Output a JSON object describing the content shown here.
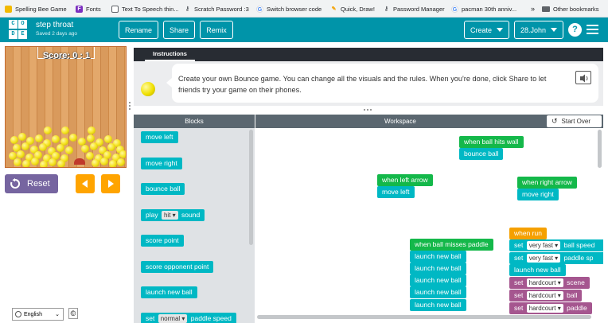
{
  "bookmarks": [
    {
      "label": "Spelling Bee Game",
      "icon": "spelling-bee-icon",
      "color": "#f2b900"
    },
    {
      "label": "Fonts",
      "icon": "fonts-icon",
      "color": "#7b2fbf"
    },
    {
      "label": "Text To Speech thin...",
      "icon": "document-icon",
      "color": "#5f6368"
    },
    {
      "label": "Scratch Password :3",
      "icon": "key-icon",
      "color": "#5f6368"
    },
    {
      "label": "Switch browser code",
      "icon": "google-icon",
      "color": "#4285f4"
    },
    {
      "label": "Quick, Draw!",
      "icon": "quick-draw-icon",
      "color": "#f4c20d"
    },
    {
      "label": "Password Manager",
      "icon": "key-icon",
      "color": "#5f6368"
    },
    {
      "label": "pacman 30th anniv...",
      "icon": "google-icon",
      "color": "#4285f4"
    },
    {
      "label": "»",
      "icon": "",
      "color": ""
    },
    {
      "label": "Other bookmarks",
      "icon": "folder-icon",
      "color": "#5f6368"
    }
  ],
  "logo_letters": [
    "C",
    "O",
    "D",
    "E"
  ],
  "project": {
    "title": "step throat",
    "saved": "Saved 2 days ago"
  },
  "header_buttons": {
    "rename": "Rename",
    "share": "Share",
    "remix": "Remix",
    "create": "Create",
    "user": "28.John",
    "help": "?"
  },
  "game": {
    "score_text": "Score: 0 : 1"
  },
  "controls": {
    "reset": "Reset"
  },
  "instructions": {
    "tab": "Instructions",
    "text": "Create your own Bounce game. You can change all the visuals and the rules. When you're done, click Share to let friends try your game on their phones."
  },
  "panels": {
    "blocks": "Blocks",
    "workspace": "Workspace",
    "start_over": "Start Over"
  },
  "toolbox": [
    {
      "label": "move left",
      "color": "teal"
    },
    {
      "label": "move right",
      "color": "teal"
    },
    {
      "label": "bounce ball",
      "color": "teal"
    },
    {
      "label": "play",
      "field": "hit",
      "suffix": "sound",
      "color": "teal"
    },
    {
      "label": "score point",
      "color": "teal"
    },
    {
      "label": "score opponent point",
      "color": "teal"
    },
    {
      "label": "launch new ball",
      "color": "teal"
    },
    {
      "label": "set",
      "field": "normal",
      "suffix": "paddle speed",
      "color": "teal"
    }
  ],
  "workspace_blocks": {
    "hits_wall": {
      "event": "when ball hits wall",
      "action": "bounce ball"
    },
    "left_arrow": {
      "event": "when left arrow",
      "action": "move left"
    },
    "right_arrow": {
      "event": "when right arrow",
      "action": "move right"
    },
    "misses_paddle": {
      "event": "when ball misses paddle",
      "actions": [
        "launch new ball",
        "launch new ball",
        "launch new ball",
        "launch new ball",
        "launch new ball"
      ]
    },
    "when_run": {
      "event": "when run",
      "actions": [
        {
          "pre": "set",
          "field": "very fast",
          "post": "ball speed",
          "color": "teal"
        },
        {
          "pre": "set",
          "field": "very fast",
          "post": "paddle sp",
          "color": "teal"
        },
        {
          "pre": "launch new ball",
          "field": "",
          "post": "",
          "color": "teal"
        },
        {
          "pre": "set",
          "field": "hardcourt",
          "post": "scene",
          "color": "purple"
        },
        {
          "pre": "set",
          "field": "hardcourt",
          "post": "ball",
          "color": "purple"
        },
        {
          "pre": "set",
          "field": "hardcourt",
          "post": "paddle",
          "color": "purple"
        }
      ]
    }
  },
  "footer": {
    "language": "English",
    "copyright": "©"
  },
  "colors": {
    "header": "#0094a9",
    "teal_block": "#00b8c4",
    "event_block": "#14b84a",
    "run_block": "#f5a000",
    "looks_block": "#a5568f",
    "reset": "#7665a0",
    "arrow": "#ffa400"
  }
}
